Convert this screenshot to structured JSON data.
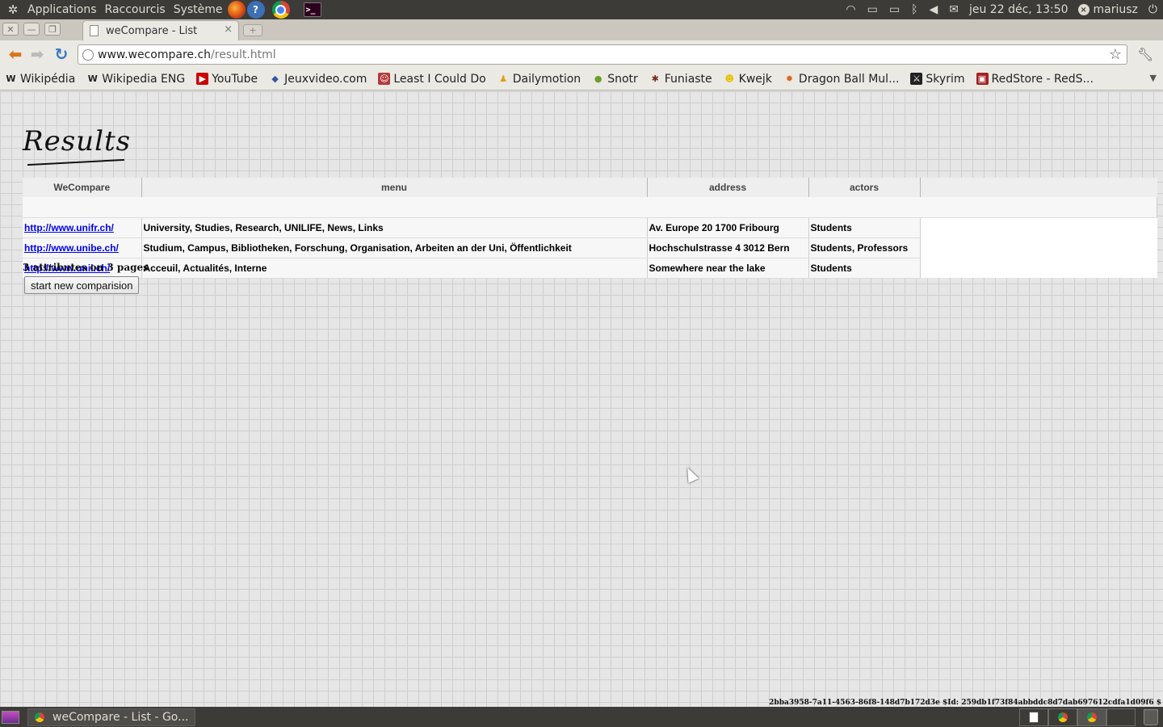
{
  "top_panel": {
    "menus": [
      "Applications",
      "Raccourcis",
      "Système"
    ],
    "clock": "jeu 22 déc, 13:50",
    "user": "mariusz",
    "launchers": [
      "firefox-icon",
      "help-icon",
      "chrome-icon",
      "terminal-icon"
    ],
    "tray_icons": [
      "wifi-icon",
      "display-icon",
      "battery-icon",
      "bluetooth-icon",
      "volume-icon",
      "mail-icon"
    ]
  },
  "browser": {
    "tab_title": "weCompare - List",
    "url_host": "www.wecompare.ch",
    "url_path": "/result.html",
    "bookmarks": [
      {
        "label": "Wikipédia",
        "icon": "W",
        "color": "#222222",
        "bg": "transparent"
      },
      {
        "label": "Wikipedia ENG",
        "icon": "W",
        "color": "#222222",
        "bg": "transparent"
      },
      {
        "label": "YouTube",
        "icon": "▶",
        "color": "#ffffff",
        "bg": "#cc0000"
      },
      {
        "label": "Jeuxvideo.com",
        "icon": "◆",
        "color": "#3355aa",
        "bg": "transparent"
      },
      {
        "label": "Least I Could Do",
        "icon": "☺",
        "color": "#ffffff",
        "bg": "#b23a3a"
      },
      {
        "label": "Dailymotion",
        "icon": "♟",
        "color": "#e0a010",
        "bg": "transparent"
      },
      {
        "label": "Snotr",
        "icon": "●",
        "color": "#6a9e2a",
        "bg": "transparent"
      },
      {
        "label": "Funiaste",
        "icon": "✱",
        "color": "#7a2a1a",
        "bg": "transparent"
      },
      {
        "label": "Kwejk",
        "icon": "☻",
        "color": "#e8c000",
        "bg": "transparent"
      },
      {
        "label": "Dragon Ball Mul...",
        "icon": "✹",
        "color": "#d9641a",
        "bg": "transparent"
      },
      {
        "label": "Skyrim",
        "icon": "⚔",
        "color": "#ffffff",
        "bg": "#222222"
      },
      {
        "label": "RedStore - RedS...",
        "icon": "▣",
        "color": "#ffffff",
        "bg": "#a32020"
      }
    ]
  },
  "page": {
    "heading": "Results",
    "table": {
      "headers": [
        "WeCompare",
        "menu",
        "address",
        "actors"
      ],
      "rows": [
        {
          "url": "http://www.unifr.ch/",
          "menu": "University, Studies, Research, UNILIFE, News, Links",
          "address": "Av. Europe 20 1700 Fribourg",
          "actors": "Students"
        },
        {
          "url": "http://www.unibe.ch/",
          "menu": "Studium, Campus, Bibliotheken, Forschung, Organisation, Arbeiten an der Uni, Öffentlichkeit",
          "address": "Hochschulstrasse 4 3012 Bern",
          "actors": "Students, Professors"
        },
        {
          "url": "http://www.unil.ch/",
          "menu": "Acceuil, Actualités, Interne",
          "address": "Somewhere near the lake",
          "actors": "Students"
        }
      ]
    },
    "summary": "3 attributes on 3 pages",
    "new_comparison_button": "start new comparision",
    "footer_id": "2bba3958-7a11-4563-86f8-148d7b172d3e $Id: 259db1f73f84abbddc8d7dab697612cdfa1d09f6 $"
  },
  "bottom_panel": {
    "task_label": "weCompare - List - Go..."
  }
}
